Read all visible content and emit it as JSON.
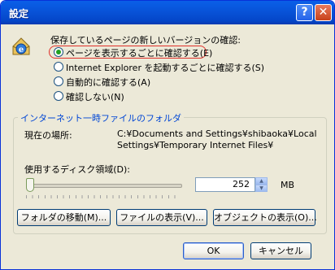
{
  "window": {
    "title": "設定"
  },
  "icons": {
    "help": "?",
    "close": "✕",
    "ie": "internet-explorer-icon"
  },
  "check": {
    "heading": "保存しているページの新しいバージョンの確認:",
    "options": [
      {
        "label": "ページを表示するごとに確認する(E)",
        "checked": true
      },
      {
        "label": "Internet Explorer を起動するごとに確認する(S)",
        "checked": false
      },
      {
        "label": "自動的に確認する(A)",
        "checked": false
      },
      {
        "label": "確認しない(N)",
        "checked": false
      }
    ]
  },
  "temp": {
    "group_title": "インターネット一時ファイルのフォルダ",
    "location_label": "現在の場所:",
    "location_line1": "C:¥Documents and Settings¥shibaoka¥Local",
    "location_line2": "Settings¥Temporary Internet Files¥",
    "disk_label": "使用するディスク領域(D):",
    "disk_value": "252",
    "disk_unit": "MB",
    "slider_fraction": 0.02
  },
  "buttons": {
    "move": "フォルダの移動(M)...",
    "view_files": "ファイルの表示(V)...",
    "view_objects": "オブジェクトの表示(O)...",
    "ok": "OK",
    "cancel": "キャンセル"
  },
  "colors": {
    "title_bar": "#0853d8",
    "group_title": "#0046d5",
    "highlight": "#e0302a"
  }
}
